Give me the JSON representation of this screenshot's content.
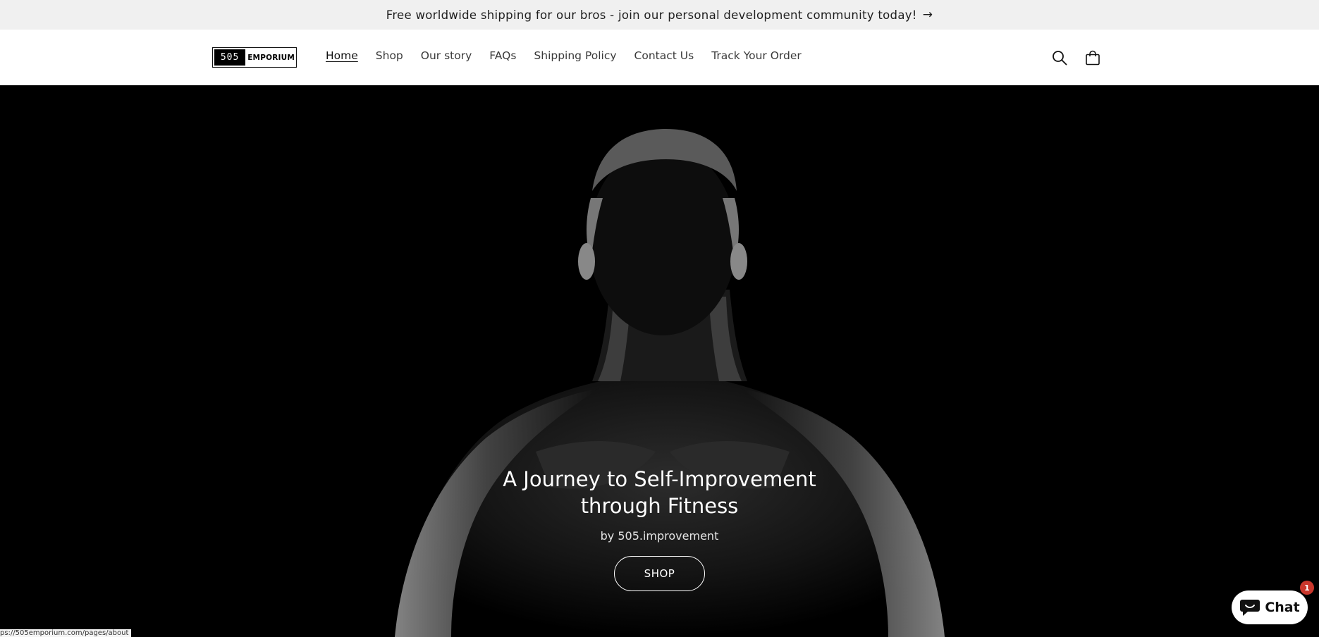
{
  "announcement": {
    "text": "Free worldwide shipping for our bros - join our personal development community today!",
    "arrow": "→"
  },
  "header": {
    "logo": {
      "number": "505",
      "word": "EMPORIUM"
    },
    "nav": [
      {
        "label": "Home",
        "active": true
      },
      {
        "label": "Shop"
      },
      {
        "label": "Our story"
      },
      {
        "label": "FAQs"
      },
      {
        "label": "Shipping Policy"
      },
      {
        "label": "Contact Us"
      },
      {
        "label": "Track Your Order"
      }
    ],
    "icons": {
      "search": "search-icon",
      "cart": "cart-icon"
    }
  },
  "hero": {
    "title": "A Journey to Self-Improvement through Fitness",
    "subtitle": "by 505.improvement",
    "button_label": "SHOP"
  },
  "status_bar": {
    "url": "ps://505emporium.com/pages/about"
  },
  "chat": {
    "label": "Chat",
    "badge": "1"
  },
  "colors": {
    "announcement_bg": "#f0f0f0",
    "hero_bg": "#000000",
    "badge": "#c9372c"
  }
}
